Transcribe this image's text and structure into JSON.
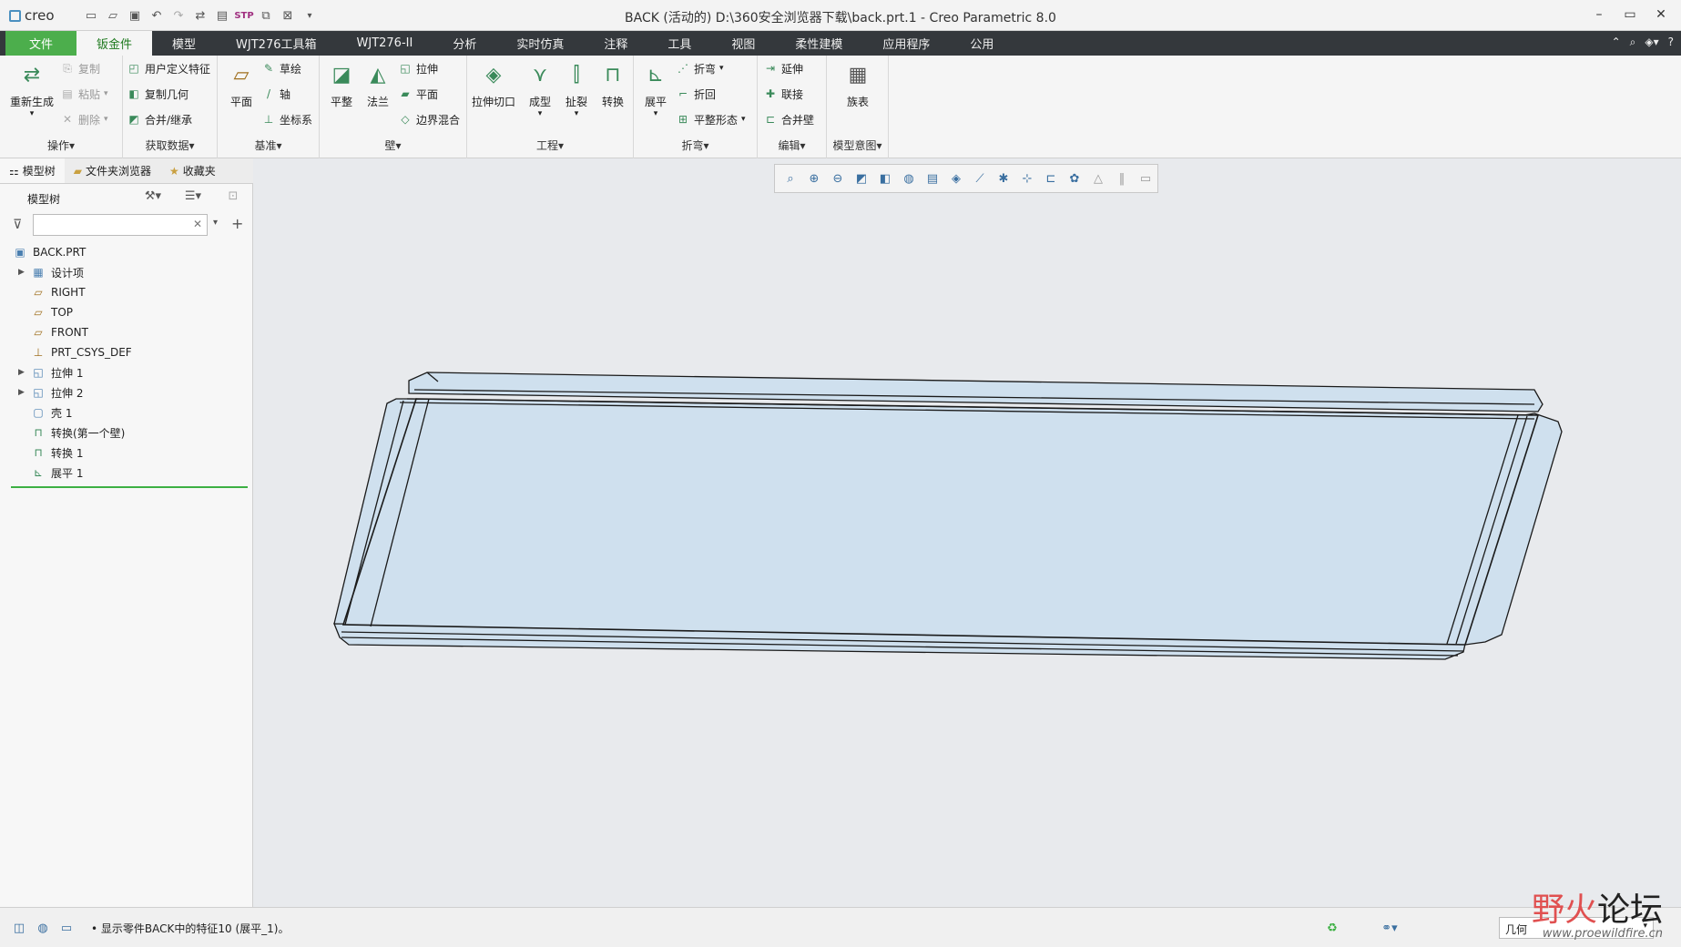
{
  "app": {
    "logo": "creo",
    "window_title": "BACK (活动的) D:\\360安全浏览器下载\\back.prt.1 - Creo Parametric 8.0"
  },
  "quick_access": [
    "new-icon",
    "open-icon",
    "save-icon",
    "undo-icon",
    "redo-icon",
    "regenerate-icon",
    "window-icon",
    "step-icon",
    "switch-window-icon",
    "close-icon",
    "customize-icon"
  ],
  "menu": {
    "tabs": [
      "文件",
      "钣金件",
      "模型",
      "WJT276工具箱",
      "WJT276-II",
      "分析",
      "实时仿真",
      "注释",
      "工具",
      "视图",
      "柔性建模",
      "应用程序",
      "公用"
    ],
    "active": "钣金件"
  },
  "ribbon": {
    "operations": {
      "label": "操作",
      "regenerate": "重新生成",
      "copy": "复制",
      "paste": "粘贴",
      "delete": "删除"
    },
    "get_data": {
      "label": "获取数据",
      "udf": "用户定义特征",
      "copy_geom": "复制几何",
      "merge": "合并/继承"
    },
    "datum": {
      "label": "基准",
      "plane": "平面",
      "sketch": "草绘",
      "axis": "轴",
      "csys": "坐标系"
    },
    "wall": {
      "label": "壁",
      "planar": "平整",
      "flange": "法兰",
      "extrude": "拉伸",
      "flat": "平面",
      "blend": "边界混合"
    },
    "engineering": {
      "label": "工程",
      "extrude_cut": "拉伸切口",
      "form": "成型",
      "rip": "扯裂",
      "convert": "转换"
    },
    "bend": {
      "label": "折弯",
      "unbend": "展平",
      "bend": "折弯",
      "bend_back": "折回",
      "flat_pattern": "平整形态"
    },
    "edit": {
      "label": "编辑",
      "extend": "延伸",
      "join": "联接",
      "merge_walls": "合并壁"
    },
    "model_intent": {
      "label": "模型意图",
      "family_table": "族表"
    }
  },
  "left_panel": {
    "tabs": [
      "模型树",
      "文件夹浏览器",
      "收藏夹"
    ],
    "tree_title": "模型树",
    "search_value": "",
    "tree": [
      {
        "label": "BACK.PRT",
        "icon": "part-icon",
        "expandable": false,
        "indent": 0
      },
      {
        "label": "设计项",
        "icon": "design-items-icon",
        "expandable": true,
        "indent": 1
      },
      {
        "label": "RIGHT",
        "icon": "datum-plane-icon",
        "expandable": false,
        "indent": 1
      },
      {
        "label": "TOP",
        "icon": "datum-plane-icon",
        "expandable": false,
        "indent": 1
      },
      {
        "label": "FRONT",
        "icon": "datum-plane-icon",
        "expandable": false,
        "indent": 1
      },
      {
        "label": "PRT_CSYS_DEF",
        "icon": "csys-icon",
        "expandable": false,
        "indent": 1
      },
      {
        "label": "拉伸 1",
        "icon": "extrude-icon",
        "expandable": true,
        "indent": 1
      },
      {
        "label": "拉伸 2",
        "icon": "extrude-icon",
        "expandable": true,
        "indent": 1
      },
      {
        "label": "壳 1",
        "icon": "shell-icon",
        "expandable": false,
        "indent": 1
      },
      {
        "label": "转换(第一个壁)",
        "icon": "convert-icon",
        "expandable": false,
        "indent": 1
      },
      {
        "label": "转换 1",
        "icon": "convert-icon",
        "expandable": false,
        "indent": 1
      },
      {
        "label": "展平 1",
        "icon": "unbend-icon",
        "expandable": false,
        "indent": 1
      }
    ]
  },
  "view_toolbar": [
    "refit-icon",
    "zoom-in-icon",
    "zoom-out-icon",
    "repaint-icon",
    "display-style-icon",
    "saved-views-icon",
    "view-manager-icon",
    "perspective-icon",
    "datum-display-icon",
    "annotation-icon",
    "spin-center-icon",
    "sections-icon",
    "appearance-icon",
    "simulation-icon",
    "pause-icon",
    "render-icon"
  ],
  "status": {
    "message": "显示零件BACK中的特征10 (展平_1)。",
    "filter_value": "几何"
  },
  "watermark": {
    "title_a": "野火",
    "title_b": "论坛",
    "url": "www.proewildfire.cn"
  },
  "colors": {
    "menubar": "#34383c",
    "file_tab": "#4cae4c",
    "model_fill": "#cfe0ee",
    "model_edge": "#1a1a1a"
  }
}
